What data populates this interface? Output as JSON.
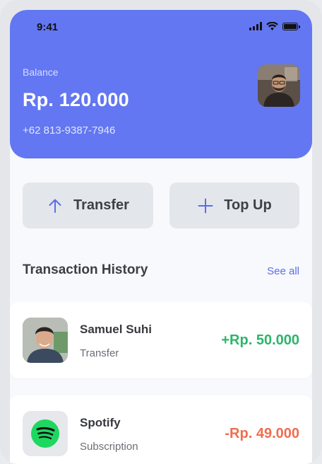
{
  "status_bar": {
    "time": "9:41",
    "icons": [
      "signal-icon",
      "wifi-icon",
      "battery-icon"
    ]
  },
  "account": {
    "balance_label": "Balance",
    "balance": "Rp. 120.000",
    "phone": "+62 813-9387-7946"
  },
  "actions": [
    {
      "label": "Transfer",
      "icon": "arrow-up-icon"
    },
    {
      "label": "Top Up",
      "icon": "plus-icon"
    }
  ],
  "history": {
    "title": "Transaction History",
    "see_all": "See all",
    "items": [
      {
        "name": "Samuel Suhi",
        "type": "Transfer",
        "amount": "+Rp. 50.000"
      },
      {
        "name": "Spotify",
        "type": "Subscription",
        "amount": "-Rp. 49.000"
      }
    ]
  },
  "colors": {
    "header": "#6377f2",
    "accent": "#5b6ee8",
    "positive": "#2cb56a",
    "negative": "#f06d4f",
    "spotify": "#1ed760"
  }
}
